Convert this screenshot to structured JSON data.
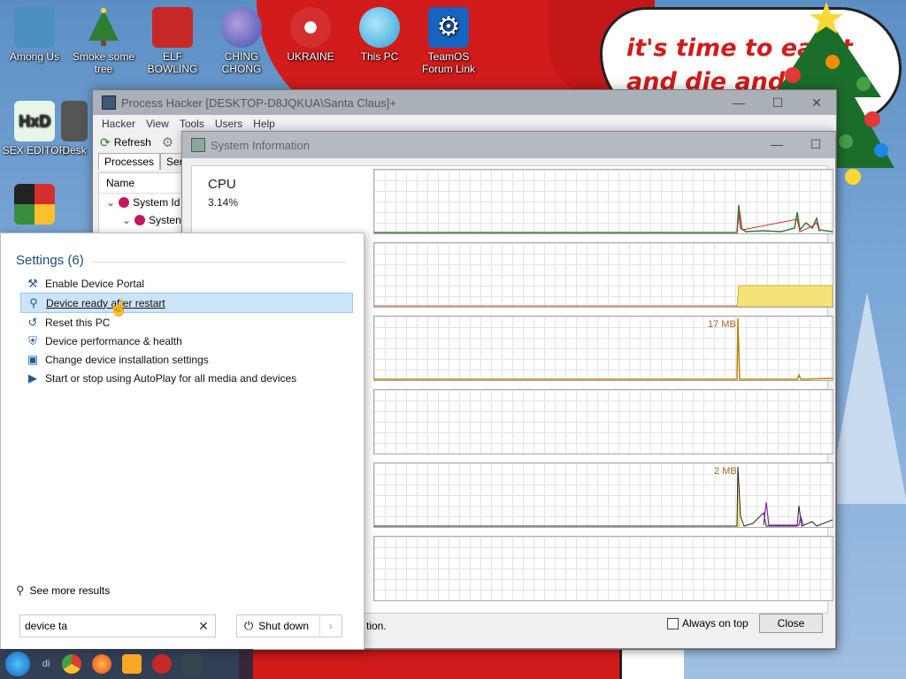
{
  "desktop": {
    "bubble_text": "it's time to eat it and die and l",
    "icons": [
      {
        "label": "Among Us",
        "color": "#4a90c2"
      },
      {
        "label": "Smoke some tree",
        "color": "#2e7d32"
      },
      {
        "label": "ELF BOWLING",
        "color": "#c62828"
      },
      {
        "label": "CHING CHONG",
        "color": "#3f51b5"
      },
      {
        "label": "UKRAINE",
        "color": "#d32f2f"
      },
      {
        "label": "This PC",
        "color": "#29a3d6"
      },
      {
        "label": "TeamOS Forum Link",
        "color": "#1565c0"
      },
      {
        "label": "SEX EDITOR",
        "color": "#4caf50"
      },
      {
        "label": "Desk",
        "color": "#555555"
      }
    ]
  },
  "process_hacker": {
    "title": "Process Hacker [DESKTOP-D8JQKUA\\Santa Claus]+",
    "menu": [
      "Hacker",
      "View",
      "Tools",
      "Users",
      "Help"
    ],
    "toolbar": {
      "refresh_label": "Refresh"
    },
    "tabs": [
      "Processes",
      "Servic"
    ],
    "list": {
      "header": "Name",
      "rows": [
        "System Id",
        "Systen"
      ]
    }
  },
  "system_info": {
    "title": "System Information",
    "cpu_label": "CPU",
    "cpu_value": "3.14%",
    "peak_labels": [
      "17 MB",
      "2 MB"
    ],
    "footer_text": "tion.",
    "always_on_top_label": "Always on top",
    "close_label": "Close"
  },
  "start_menu": {
    "section_title": "Settings (6)",
    "results": [
      {
        "label": "Enable Device Portal",
        "icon": "tools-icon"
      },
      {
        "label": "Device ready after restart",
        "icon": "search-magnifier-icon"
      },
      {
        "label": "Reset this PC",
        "icon": "reset-icon"
      },
      {
        "label": "Device performance & health",
        "icon": "shield-icon"
      },
      {
        "label": "Change device installation settings",
        "icon": "computer-icon"
      },
      {
        "label": "Start or stop using AutoPlay for all media and devices",
        "icon": "autoplay-icon"
      }
    ],
    "see_more_label": "See more results",
    "search_value": "device ta",
    "shutdown_label": "Shut down"
  },
  "taskbar": {
    "partial_text": "di"
  },
  "colors": {
    "accent_selection": "#cce4f7",
    "graph_line": "#2e7d32",
    "graph_fill_io": "#f5e278"
  }
}
